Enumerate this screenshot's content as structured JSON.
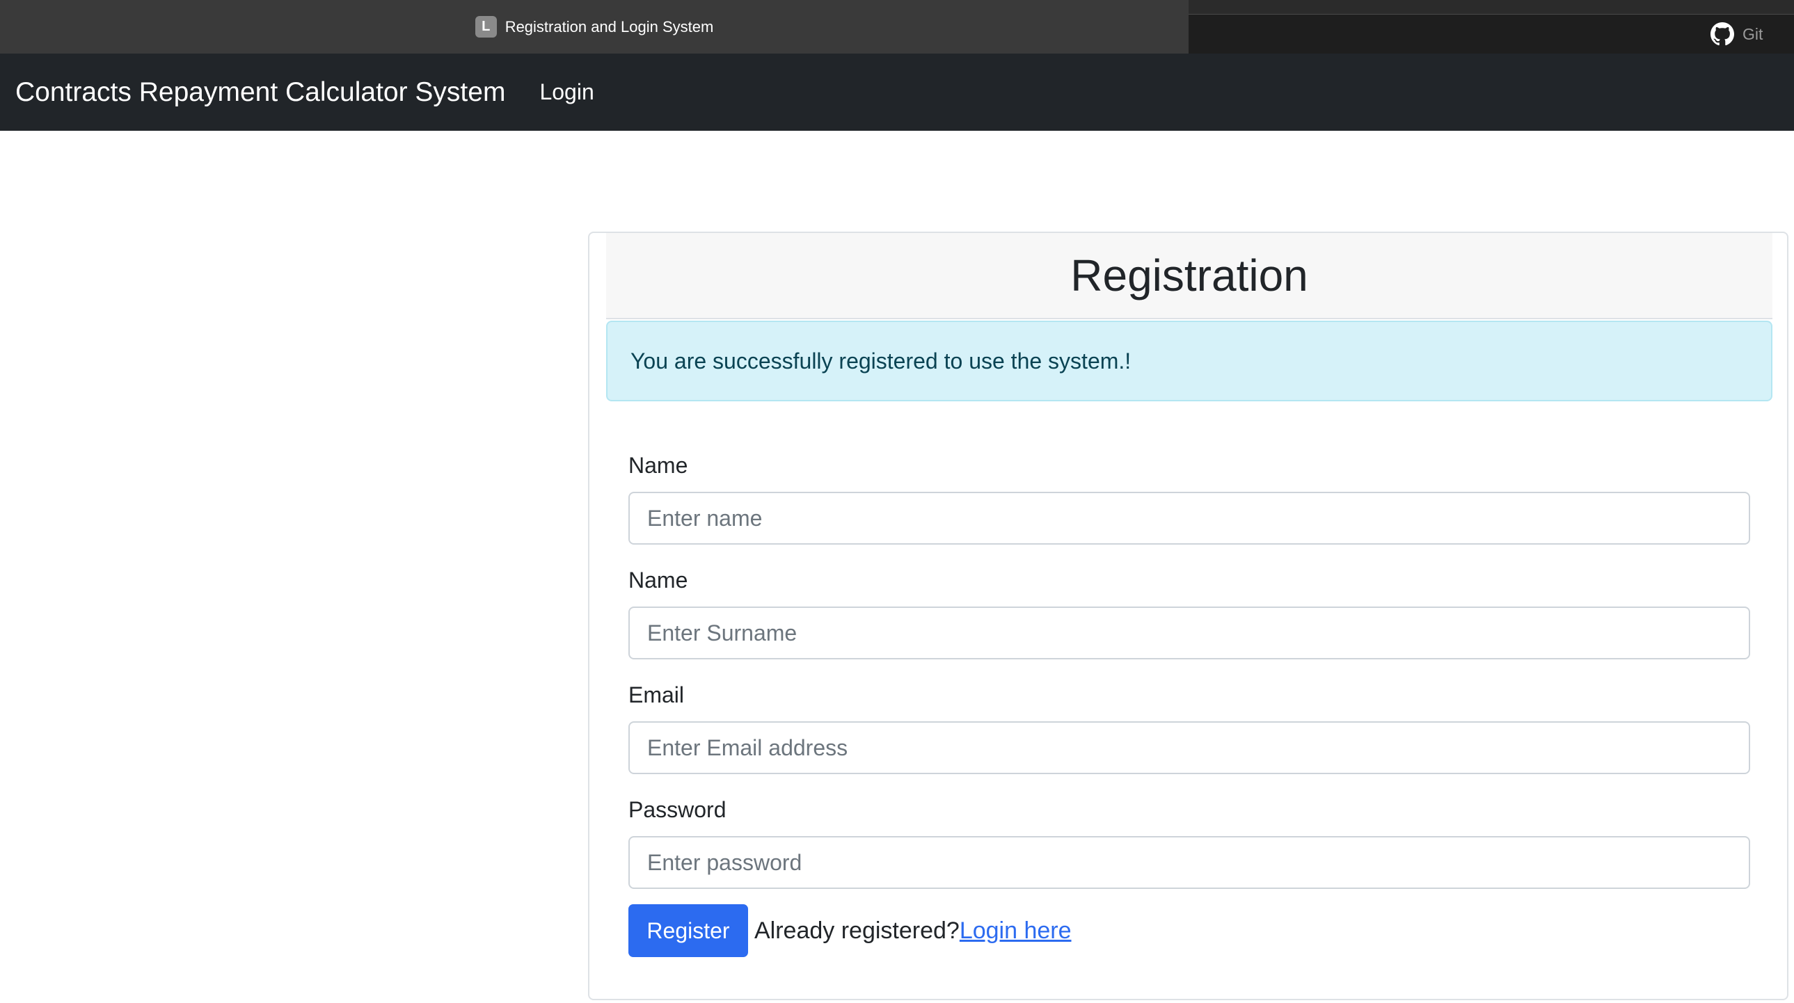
{
  "browser": {
    "tab_favicon_letter": "L",
    "active_tab_title": "Registration and Login System",
    "github_tab_label": "Git"
  },
  "navbar": {
    "brand": "Contracts Repayment Calculator System",
    "login_link": "Login"
  },
  "card": {
    "title": "Registration",
    "alert_message": "You are successfully registered to use the system.!"
  },
  "form": {
    "fields": [
      {
        "label": "Name",
        "placeholder": "Enter name",
        "value": ""
      },
      {
        "label": "Name",
        "placeholder": "Enter Surname",
        "value": ""
      },
      {
        "label": "Email",
        "placeholder": "Enter Email address",
        "value": ""
      },
      {
        "label": "Password",
        "placeholder": "Enter password",
        "value": ""
      }
    ],
    "register_button": "Register",
    "already_registered_text": "Already registered?",
    "login_here_link": "Login here"
  },
  "colors": {
    "navbar_bg": "#212529",
    "primary": "#2c6bf0",
    "alert_bg": "#d6f2f9",
    "alert_text": "#0a4353"
  }
}
